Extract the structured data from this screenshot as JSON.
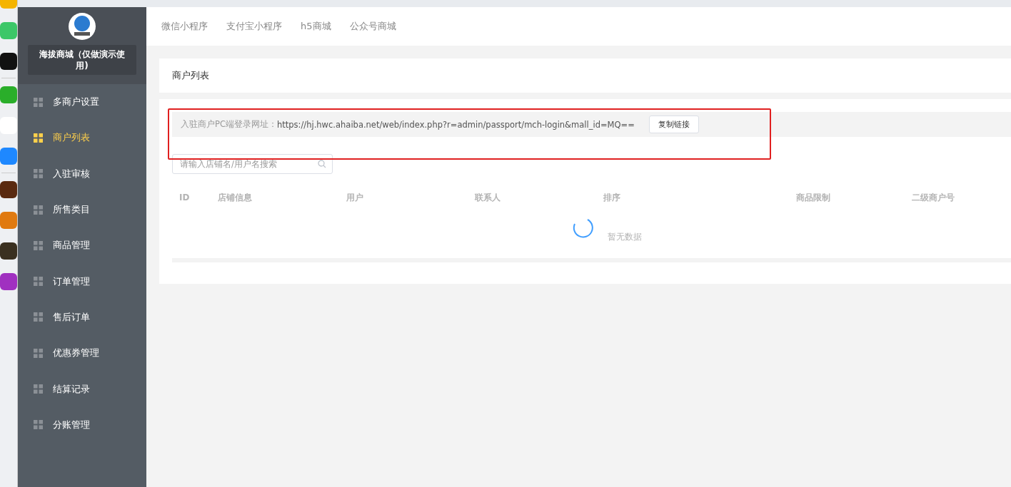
{
  "brand": {
    "title": "海拔商城（仅做演示使用)"
  },
  "menu": [
    {
      "label": "多商户设置",
      "selected": false
    },
    {
      "label": "商户列表",
      "selected": true
    },
    {
      "label": "入驻审核",
      "selected": false
    },
    {
      "label": "所售类目",
      "selected": false
    },
    {
      "label": "商品管理",
      "selected": false
    },
    {
      "label": "订单管理",
      "selected": false
    },
    {
      "label": "售后订单",
      "selected": false
    },
    {
      "label": "优惠券管理",
      "selected": false
    },
    {
      "label": "结算记录",
      "selected": false
    },
    {
      "label": "分账管理",
      "selected": false
    }
  ],
  "top_tabs": [
    "微信小程序",
    "支付宝小程序",
    "h5商城",
    "公众号商城"
  ],
  "page_title": "商户列表",
  "login_url": {
    "label": "入驻商户PC端登录网址：",
    "url": "https://hj.hwc.ahaiba.net/web/index.php?r=admin/passport/mch-login&mall_id=MQ==",
    "button": "复制链接"
  },
  "search": {
    "placeholder": "请输入店铺名/用户名搜索"
  },
  "table": {
    "loading": true,
    "columns": [
      "ID",
      "店铺信息",
      "用户",
      "联系人",
      "排序",
      "商品限制",
      "二级商户号"
    ],
    "empty_text": "暂无数据"
  }
}
